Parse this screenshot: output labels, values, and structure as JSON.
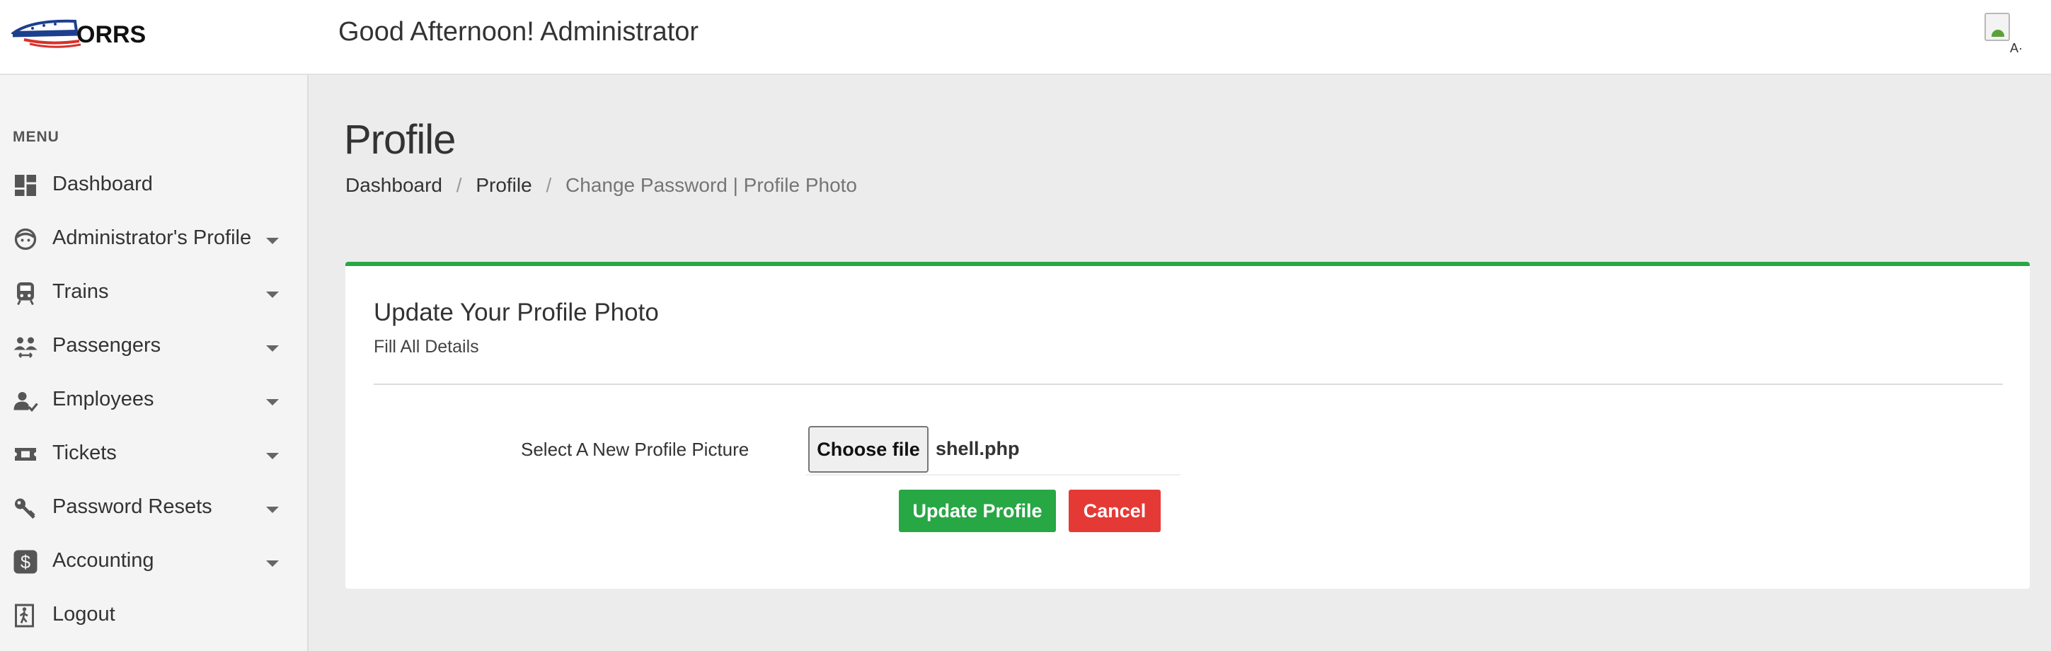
{
  "header": {
    "logo_text": "ORRS",
    "greeting": "Good Afternoon! Administrator",
    "avatar_alt": "A·"
  },
  "sidebar": {
    "heading": "MENU",
    "items": [
      {
        "label": "Dashboard",
        "icon": "dashboard-icon",
        "has_caret": false
      },
      {
        "label": "Administrator's Profile",
        "icon": "face-icon",
        "has_caret": true
      },
      {
        "label": "Trains",
        "icon": "train-icon",
        "has_caret": true
      },
      {
        "label": "Passengers",
        "icon": "people-arrows-icon",
        "has_caret": true
      },
      {
        "label": "Employees",
        "icon": "employee-check-icon",
        "has_caret": true
      },
      {
        "label": "Tickets",
        "icon": "ticket-icon",
        "has_caret": true
      },
      {
        "label": "Password Resets",
        "icon": "key-icon",
        "has_caret": true
      },
      {
        "label": "Accounting",
        "icon": "dollar-icon",
        "has_caret": true
      },
      {
        "label": "Logout",
        "icon": "exit-door-icon",
        "has_caret": false
      }
    ]
  },
  "page": {
    "title": "Profile",
    "breadcrumb": {
      "item1": "Dashboard",
      "item2": "Profile",
      "current": "Change Password | Profile Photo",
      "separator": "/"
    }
  },
  "card": {
    "title": "Update Your Profile Photo",
    "subtitle": "Fill All Details",
    "field_label": "Select A New Profile Picture",
    "choose_label": "Choose file",
    "file_name": "shell.php",
    "update_label": "Update Profile",
    "cancel_label": "Cancel"
  },
  "colors": {
    "accent_green": "#28a745",
    "cancel_red": "#e53935",
    "logo_blue": "#1d3f8f",
    "logo_red": "#d9302b"
  }
}
